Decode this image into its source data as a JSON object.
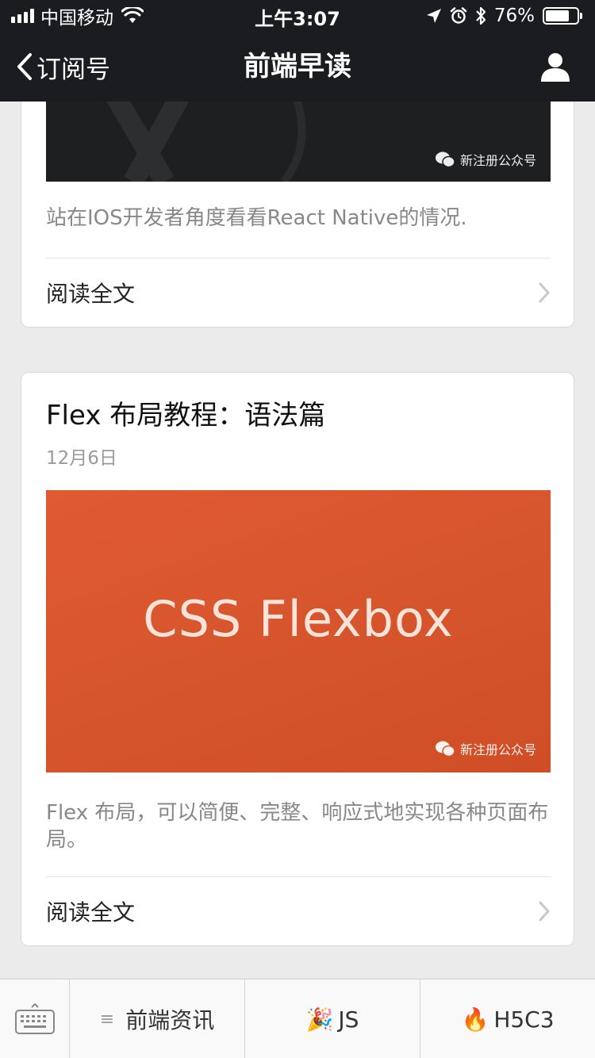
{
  "status_bar": {
    "carrier": "中国移动",
    "time": "上午3:07",
    "battery_percent": "76%",
    "battery_level": 0.76
  },
  "nav": {
    "back_label": "订阅号",
    "title": "前端早读"
  },
  "articles": [
    {
      "watermark": "新注册公众号",
      "digest": "站在IOS开发者角度看看React Native的情况.",
      "read_more": "阅读全文"
    },
    {
      "title": "Flex 布局教程：语法篇",
      "date": "12月6日",
      "cover_text": "CSS Flexbox",
      "watermark": "新注册公众号",
      "digest": "Flex 布局，可以简便、完整、响应式地实现各种页面布局。",
      "read_more": "阅读全文"
    }
  ],
  "menu": {
    "items": [
      {
        "label": "前端资讯",
        "icon": "menu-lines-icon"
      },
      {
        "label": "JS",
        "icon": "party-popper-icon",
        "emoji": "🎉"
      },
      {
        "label": "H5C3",
        "icon": "fire-icon",
        "emoji": "🔥"
      }
    ]
  },
  "colors": {
    "header_bg": "#1b1c20",
    "page_bg": "#ebebeb",
    "cover_orange": "#d5542b"
  }
}
